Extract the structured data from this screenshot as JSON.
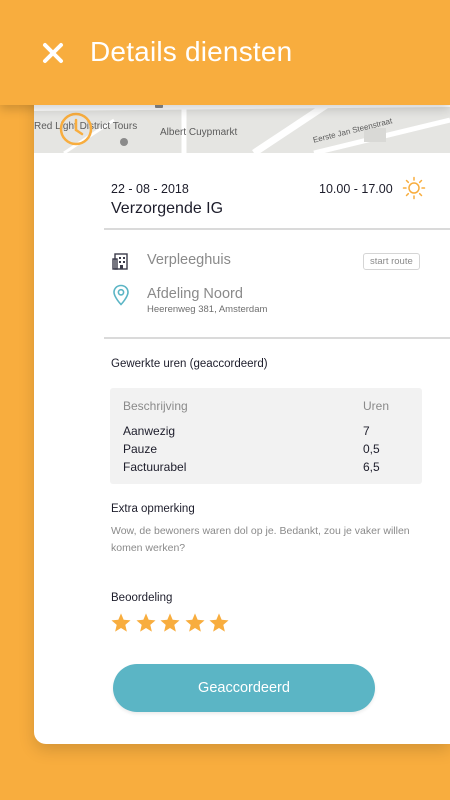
{
  "header": {
    "title": "Details diensten"
  },
  "map": {
    "labels": [
      "Red Light District Tours",
      "Albert Cuypmarkt",
      "Eerste Jan Steenstraat"
    ]
  },
  "shift": {
    "date": "22 - 08 - 2018",
    "time": "10.00 - 17.00",
    "role": "Verzorgende IG"
  },
  "location": {
    "name": "Verpleeghuis",
    "start_route": "start route",
    "department": "Afdeling Noord",
    "address": "Heerenweg 381, Amsterdam"
  },
  "hours": {
    "title": "Gewerkte uren (geaccordeerd)",
    "columns": [
      "Beschrijving",
      "Uren"
    ],
    "rows": [
      {
        "label": "Aanwezig",
        "value": "7"
      },
      {
        "label": "Pauze",
        "value": "0,5"
      },
      {
        "label": "Factuurabel",
        "value": "6,5"
      }
    ]
  },
  "remark": {
    "title": "Extra opmerking",
    "text": "Wow, de bewoners waren dol op je. Bedankt, zou je vaker willen komen werken?"
  },
  "rating": {
    "title": "Beoordeling",
    "stars": 5,
    "max": 5
  },
  "actions": {
    "approve": "Geaccordeerd"
  },
  "colors": {
    "accent": "#F8AD3E",
    "button": "#5BB5C5",
    "pin": "#5BB5C5",
    "text": "#1D1D2B"
  },
  "icons": [
    "close-icon",
    "clock-icon",
    "sun-icon",
    "building-icon",
    "location-pin-icon",
    "star-icon"
  ]
}
